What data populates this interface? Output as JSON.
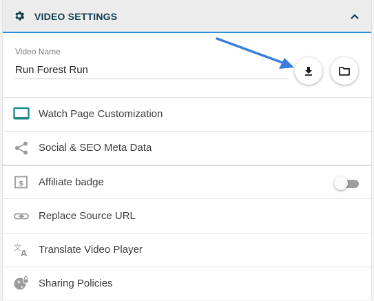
{
  "header": {
    "title": "VIDEO SETTINGS",
    "icon": "gear-icon",
    "collapse_icon": "chevron-up-icon"
  },
  "video_name": {
    "label": "Video Name",
    "value": "Run Forest Run"
  },
  "actions": {
    "download_icon": "download-icon",
    "folder_icon": "folder-icon"
  },
  "menu": [
    {
      "label": "Watch Page Customization",
      "icon": "monitor-icon"
    },
    {
      "label": "Social & SEO Meta Data",
      "icon": "share-icon"
    },
    {
      "label": "Affiliate badge",
      "icon": "badge-icon",
      "toggle": false
    },
    {
      "label": "Replace Source URL",
      "icon": "link-icon"
    },
    {
      "label": "Translate Video Player",
      "icon": "translate-icon"
    },
    {
      "label": "Sharing Policies",
      "icon": "globe-lock-icon"
    }
  ],
  "colors": {
    "accent": "#2f8ed6",
    "header_text": "#0d3b4f",
    "watch_icon": "#1f8a8a",
    "annotation_arrow": "#3b7ddd"
  }
}
